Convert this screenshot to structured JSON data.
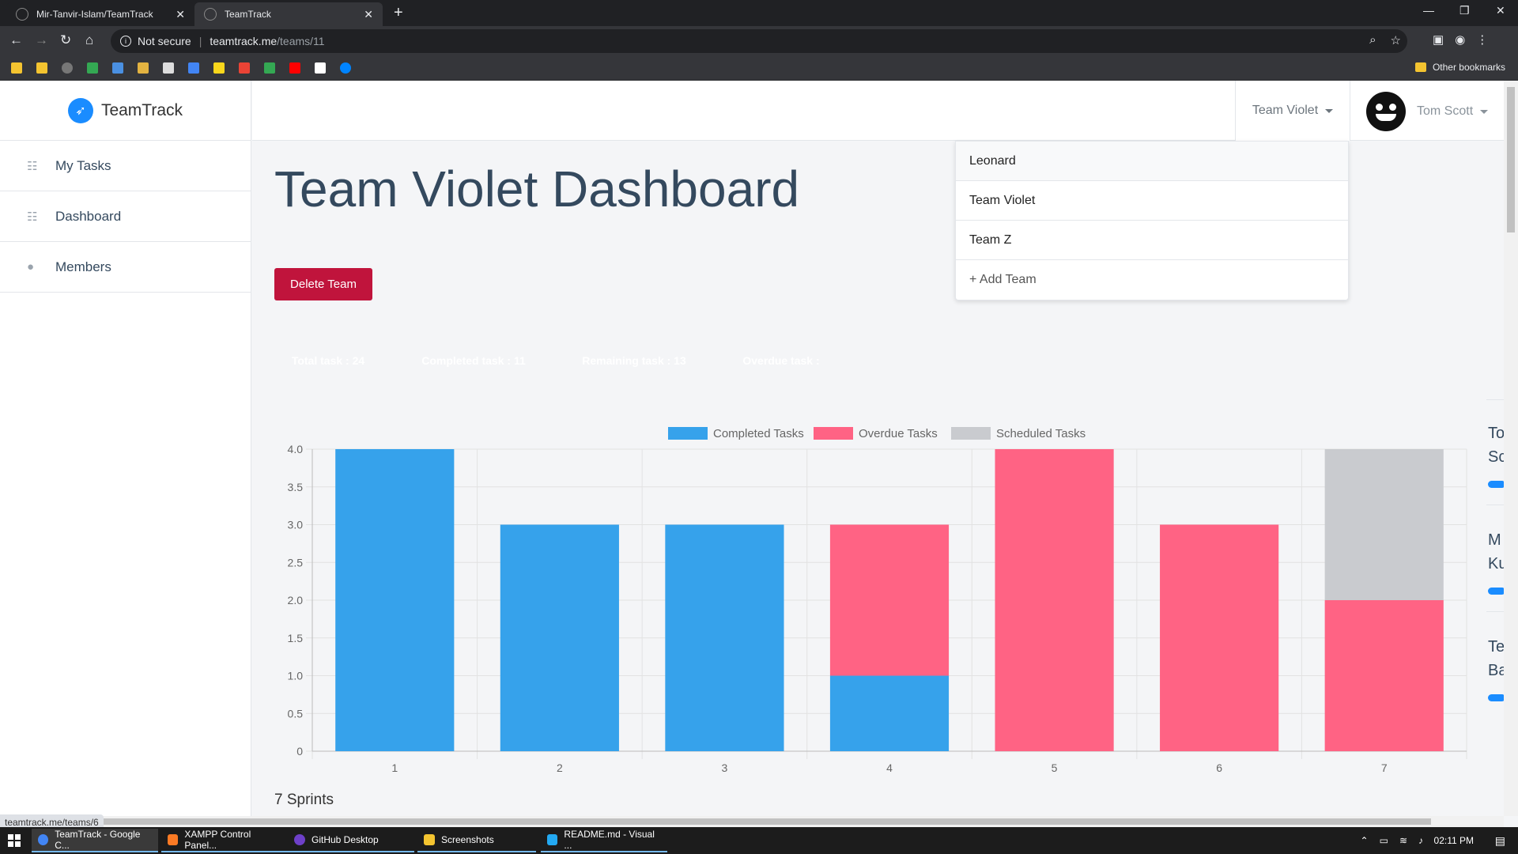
{
  "browser": {
    "tabs": [
      {
        "title": "Mir-Tanvir-Islam/TeamTrack"
      },
      {
        "title": "TeamTrack"
      }
    ],
    "omnibox": {
      "security": "Not secure",
      "host": "teamtrack.me",
      "path": "/teams/11"
    },
    "bookmarks": {
      "other_label": "Other bookmarks"
    },
    "status_url": "teamtrack.me/teams/6"
  },
  "app": {
    "brand": "TeamTrack",
    "sidebar": [
      {
        "label": "My Tasks",
        "icon": "list-icon"
      },
      {
        "label": "Dashboard",
        "icon": "list-icon"
      },
      {
        "label": "Members",
        "icon": "user-icon"
      }
    ],
    "team_toggle": "Team Violet",
    "user_name": "Tom Scott",
    "team_dropdown": [
      "Leonard",
      "Team Violet",
      "Team Z",
      "+ Add Team"
    ],
    "page_title": "Team Violet Dashboard",
    "delete_button": "Delete Team",
    "stats": [
      {
        "label": "Total task : 24",
        "color": "#8a8d91"
      },
      {
        "label": "Completed task : 11",
        "color": "#58a6f5"
      },
      {
        "label": "Remaining task : 13",
        "color": "#8a8d91"
      },
      {
        "label": "Overdue task :",
        "color": "#d9647c"
      }
    ],
    "sprints_label": "7 Sprints",
    "right_panel": [
      {
        "l1": "To",
        "l2": "Sc"
      },
      {
        "l1": "M",
        "l2": "Ku"
      },
      {
        "l1": "Te",
        "l2": "Ba"
      }
    ]
  },
  "chart_data": {
    "type": "bar",
    "stacked": true,
    "categories": [
      "1",
      "2",
      "3",
      "4",
      "5",
      "6",
      "7"
    ],
    "series": [
      {
        "name": "Completed Tasks",
        "color": "#36a2eb",
        "values": [
          4,
          3,
          3,
          1,
          0,
          0,
          0
        ]
      },
      {
        "name": "Overdue Tasks",
        "color": "#ff6384",
        "values": [
          0,
          0,
          0,
          2,
          4,
          3,
          2
        ]
      },
      {
        "name": "Scheduled Tasks",
        "color": "#c9cbcf",
        "values": [
          0,
          0,
          0,
          0,
          0,
          0,
          2
        ]
      }
    ],
    "y_ticks": [
      "0",
      "0.5",
      "1.0",
      "1.5",
      "2.0",
      "2.5",
      "3.0",
      "3.5",
      "4.0"
    ],
    "ylim": [
      0,
      4
    ],
    "legend": "top",
    "grid": true
  },
  "taskbar": {
    "items": [
      "TeamTrack - Google C...",
      "XAMPP Control Panel...",
      "GitHub Desktop",
      "Screenshots",
      "README.md - Visual ..."
    ],
    "clock": "02:11 PM"
  }
}
